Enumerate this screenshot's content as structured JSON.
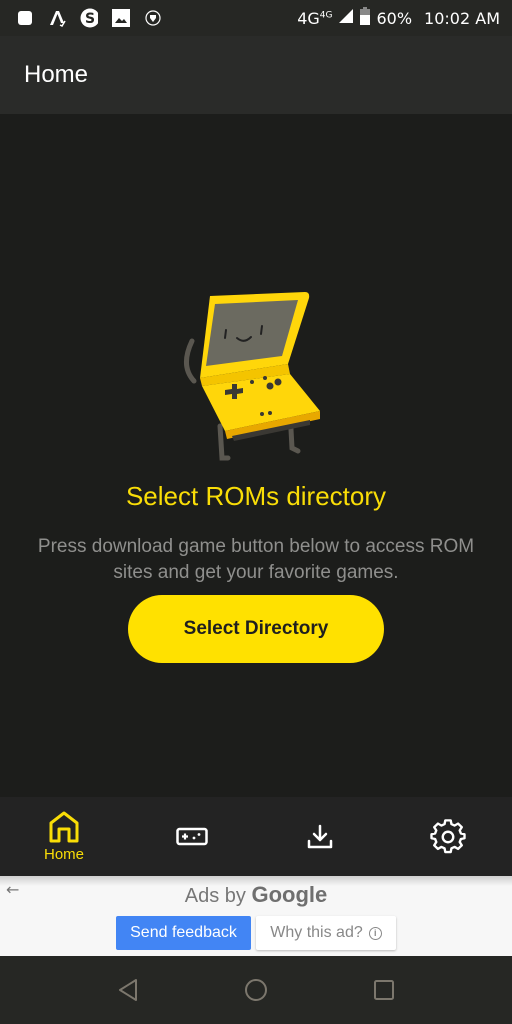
{
  "status_bar": {
    "network": "4G",
    "network_small": "4G",
    "battery": "60%",
    "time": "10:02 AM",
    "notification_icons": [
      "app-square-icon",
      "font-app-icon",
      "skype-icon",
      "gallery-icon",
      "vpn-shield-icon"
    ]
  },
  "app_bar": {
    "title": "Home"
  },
  "empty_state": {
    "title": "Select ROMs directory",
    "description": "Press download game button below to access ROM sites and get your favorite games.",
    "button_label": "Select Directory",
    "illustration": "handheld-console-character"
  },
  "bottom_nav": {
    "items": [
      {
        "id": "home",
        "label": "Home",
        "icon": "home-icon",
        "active": true
      },
      {
        "id": "games",
        "label": "",
        "icon": "gamepad-icon",
        "active": false
      },
      {
        "id": "downloads",
        "label": "",
        "icon": "download-icon",
        "active": false
      },
      {
        "id": "settings",
        "label": "",
        "icon": "gear-icon",
        "active": false
      }
    ]
  },
  "ad": {
    "ads_by": "Ads by",
    "google": "Google",
    "send_feedback": "Send feedback",
    "why_this_ad": "Why this ad?",
    "info_glyph": "i",
    "back_glyph": "←"
  },
  "colors": {
    "accent": "#f9dd07",
    "button": "#ffe100",
    "background": "#1c1d1b",
    "feedback_blue": "#4285f4"
  }
}
